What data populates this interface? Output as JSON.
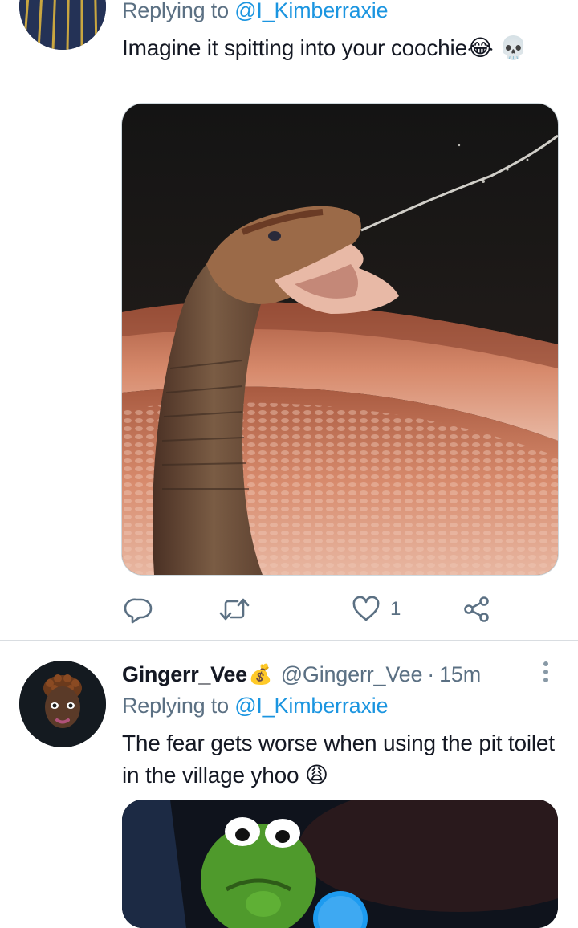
{
  "tweets": [
    {
      "reply_prefix": "Replying to",
      "reply_handle": "@I_Kimberraxie",
      "text": "Imagine it spitting into your coochie😂 💀",
      "media": "snake-photo",
      "actions": {
        "reply_icon": "reply-icon",
        "retweet_icon": "retweet-icon",
        "like_icon": "heart-icon",
        "like_count": "1",
        "share_icon": "share-icon"
      }
    },
    {
      "display_name": "Gingerr_Vee",
      "name_emoji": "💰",
      "handle": "@Gingerr_Vee",
      "separator": "·",
      "time": "15m",
      "reply_prefix": "Replying to",
      "reply_handle": "@I_Kimberraxie",
      "text": "The fear gets worse when using the pit toilet in the village yhoo 😩",
      "media": "kermit-photo"
    }
  ],
  "colors": {
    "link": "#1b95e0",
    "secondary_text": "#5b7083",
    "primary_text": "#141823",
    "divider": "#d9dde1"
  }
}
